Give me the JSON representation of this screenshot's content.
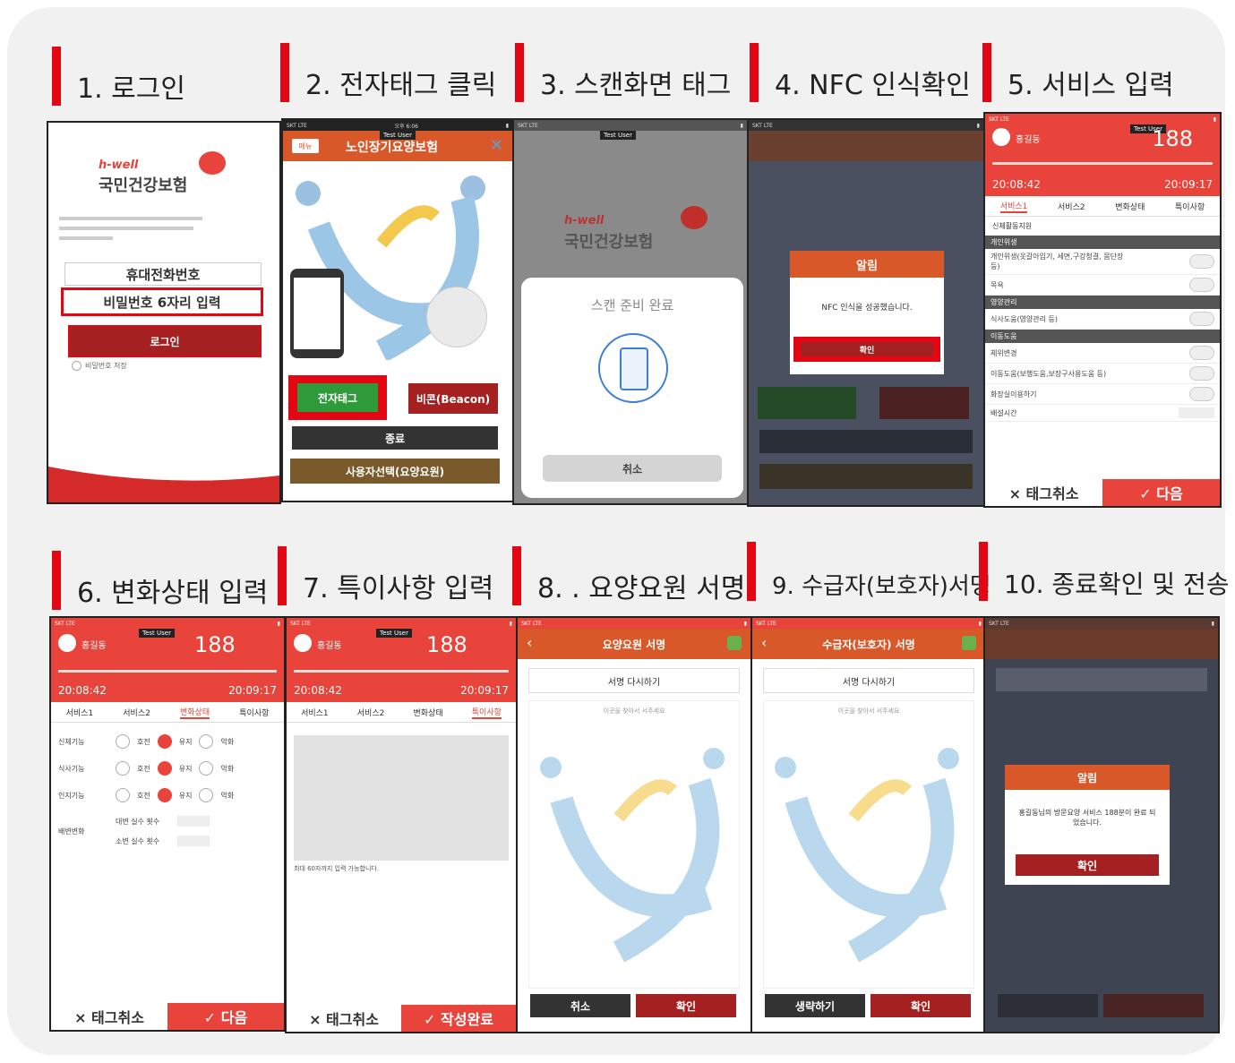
{
  "steps": [
    {
      "title": "1. 로그인"
    },
    {
      "title": "2. 전자태그 클릭"
    },
    {
      "title": "3. 스캔화면 태그"
    },
    {
      "title": "4. NFC 인식확인"
    },
    {
      "title": "5. 서비스 입력"
    },
    {
      "title": "6. 변화상태 입력"
    },
    {
      "title": "7. 특이사항 입력"
    },
    {
      "title": "8. . 요양요원 서명"
    },
    {
      "title": "9. 수급자(보호자)서명"
    },
    {
      "title": "10. 종료확인 및 전송"
    }
  ],
  "login": {
    "brand_en": "h-well",
    "brand_ko": "국민건강보험",
    "phone_field": "휴대전화번호",
    "password_field": "비밀번호 6자리 입력",
    "login_button": "로그인",
    "save_password": "비밀번호 저장"
  },
  "home": {
    "menu": "메뉴",
    "title": "노인장기요양보험",
    "test_user": "Test User",
    "nfc_button": "전자태그",
    "beacon_button": "비콘(Beacon)",
    "exit_button": "종료",
    "select_user_button": "사용자선택(요양요원)"
  },
  "scan": {
    "brand_en": "h-well",
    "brand_ko": "국민건강보험",
    "ready_text": "스캔 준비 완료",
    "cancel_button": "취소"
  },
  "nfc": {
    "alert_title": "알림",
    "alert_message": "NFC 인식을 성공했습니다.",
    "confirm_button": "확인"
  },
  "service": {
    "user_name": "홍길동",
    "count": "188",
    "start_time": "20:08:42",
    "end_time": "20:09:17",
    "tabs": [
      "서비스1",
      "서비스2",
      "변화상태",
      "특이사항"
    ],
    "section_title": "신체활동지원",
    "groups": [
      {
        "name": "개인위생",
        "items": [
          "개인위생(옷갈아입기, 세면,구강청결, 몸단장 등)",
          "목욕"
        ]
      },
      {
        "name": "영양관리",
        "items": [
          "식사도움(영양관리 등)"
        ]
      },
      {
        "name": "이동도움",
        "items": [
          "체위변경",
          "이동도움(보행도움,보장구사용도움 등)",
          "화장실이용하기",
          "배설시간"
        ]
      }
    ],
    "cancel_tag": "× 태그취소",
    "next": "✓ 다음"
  },
  "change": {
    "tabs": [
      "서비스1",
      "서비스2",
      "변화상태",
      "특이사항"
    ],
    "rows": [
      {
        "label": "신체기능",
        "opts": [
          "호전",
          "유지",
          "악화"
        ]
      },
      {
        "label": "식사기능",
        "opts": [
          "호전",
          "유지",
          "악화"
        ]
      },
      {
        "label": "인지기능",
        "opts": [
          "호전",
          "유지",
          "악화"
        ]
      }
    ],
    "excretion_label": "배변변화",
    "stool": "대변 실수 횟수",
    "urine": "소변 실수 횟수",
    "cancel_tag": "× 태그취소",
    "next": "✓ 다음"
  },
  "note": {
    "hint": "최대 60자까지 입력 가능합니다.",
    "cancel_tag": "× 태그취소",
    "complete": "✓ 작성완료"
  },
  "sign_worker": {
    "title": "요양요원 서명",
    "redo": "서명 다시하기",
    "hint": "이곳을 찾아서 서주세요",
    "cancel": "취소",
    "confirm": "확인"
  },
  "sign_recipient": {
    "title": "수급자(보호자) 서명",
    "redo": "서명 다시하기",
    "hint": "이곳을 찾아서 서주세요",
    "skip": "생략하기",
    "confirm": "확인"
  },
  "finish": {
    "alert_title": "알림",
    "alert_message": "홍길동님의 방문요양 서비스 188분이 완료 되었습니다.",
    "confirm": "확인"
  },
  "colors": {
    "accent": "#e8443b",
    "dark_red": "#a52020",
    "brand_orange": "#d9582a"
  }
}
